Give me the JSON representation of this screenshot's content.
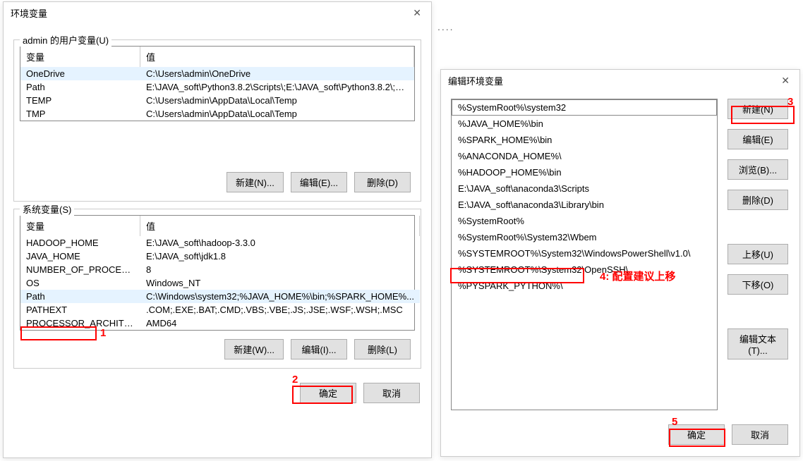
{
  "dots": "....",
  "envDialog": {
    "title": "环境变量",
    "userGroupLabel": "admin 的用户变量(U)",
    "headerVar": "变量",
    "headerVal": "值",
    "userVars": [
      {
        "name": "OneDrive",
        "value": "C:\\Users\\admin\\OneDrive",
        "selected": true
      },
      {
        "name": "Path",
        "value": "E:\\JAVA_soft\\Python3.8.2\\Scripts\\;E:\\JAVA_soft\\Python3.8.2\\;C:...",
        "selected": false
      },
      {
        "name": "TEMP",
        "value": "C:\\Users\\admin\\AppData\\Local\\Temp",
        "selected": false
      },
      {
        "name": "TMP",
        "value": "C:\\Users\\admin\\AppData\\Local\\Temp",
        "selected": false
      }
    ],
    "userBtns": {
      "new": "新建(N)...",
      "edit": "编辑(E)...",
      "del": "删除(D)"
    },
    "sysGroupLabel": "系统变量(S)",
    "sysVars": [
      {
        "name": "HADOOP_HOME",
        "value": "E:\\JAVA_soft\\hadoop-3.3.0",
        "selected": false
      },
      {
        "name": "JAVA_HOME",
        "value": "E:\\JAVA_soft\\jdk1.8",
        "selected": false
      },
      {
        "name": "NUMBER_OF_PROCESSORS",
        "value": "8",
        "selected": false
      },
      {
        "name": "OS",
        "value": "Windows_NT",
        "selected": false
      },
      {
        "name": "Path",
        "value": "C:\\Windows\\system32;%JAVA_HOME%\\bin;%SPARK_HOME%...",
        "selected": true
      },
      {
        "name": "PATHEXT",
        "value": ".COM;.EXE;.BAT;.CMD;.VBS;.VBE;.JS;.JSE;.WSF;.WSH;.MSC",
        "selected": false
      },
      {
        "name": "PROCESSOR_ARCHITECT...",
        "value": "AMD64",
        "selected": false
      }
    ],
    "sysBtns": {
      "new": "新建(W)...",
      "edit": "编辑(I)...",
      "del": "删除(L)"
    },
    "footer": {
      "ok": "确定",
      "cancel": "取消"
    }
  },
  "editDialog": {
    "title": "编辑环境变量",
    "items": [
      {
        "text": "%SystemRoot%\\system32",
        "selected": true
      },
      {
        "text": "%JAVA_HOME%\\bin",
        "selected": false
      },
      {
        "text": "%SPARK_HOME%\\bin",
        "selected": false
      },
      {
        "text": "%ANACONDA_HOME%\\",
        "selected": false
      },
      {
        "text": "%HADOOP_HOME%\\bin",
        "selected": false
      },
      {
        "text": "E:\\JAVA_soft\\anaconda3\\Scripts",
        "selected": false
      },
      {
        "text": "E:\\JAVA_soft\\anaconda3\\Library\\bin",
        "selected": false
      },
      {
        "text": "%SystemRoot%",
        "selected": false
      },
      {
        "text": "%SystemRoot%\\System32\\Wbem",
        "selected": false
      },
      {
        "text": "%SYSTEMROOT%\\System32\\WindowsPowerShell\\v1.0\\",
        "selected": false
      },
      {
        "text": "%SYSTEMROOT%\\System32\\OpenSSH\\",
        "selected": false
      },
      {
        "text": "%PYSPARK_PYTHON%\\",
        "selected": false
      }
    ],
    "btns": {
      "new": "新建(N)",
      "edit": "编辑(E)",
      "browse": "浏览(B)...",
      "del": "删除(D)",
      "up": "上移(U)",
      "down": "下移(O)",
      "editText": "编辑文本(T)..."
    },
    "footer": {
      "ok": "确定",
      "cancel": "取消"
    }
  },
  "annotations": {
    "a1": "1",
    "a2": "2",
    "a3": "3",
    "a4": "4: 配置建议上移",
    "a5": "5"
  }
}
